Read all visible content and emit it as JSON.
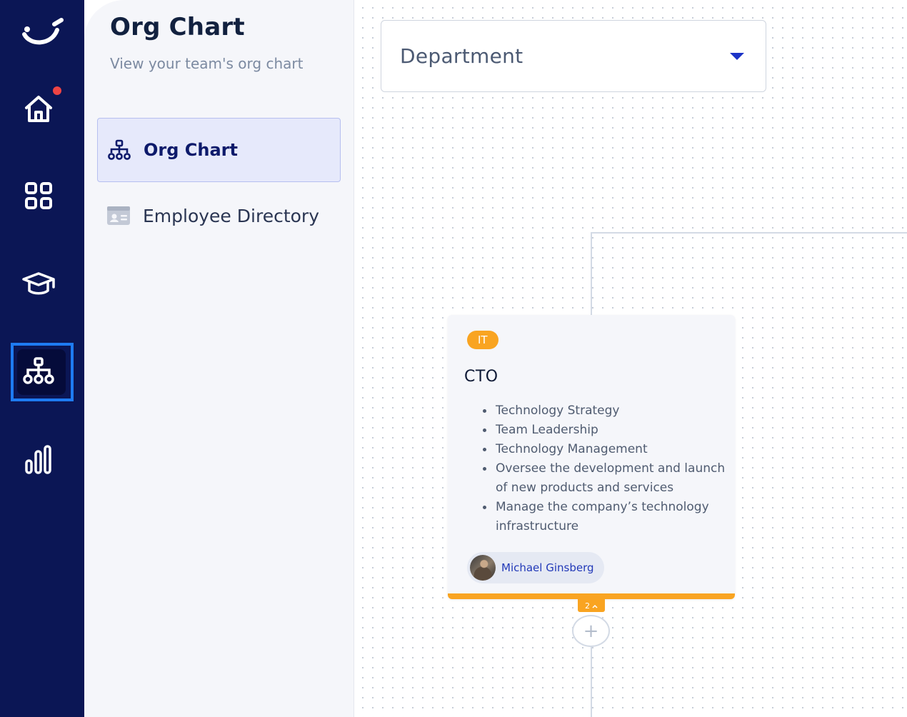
{
  "panel": {
    "title": "Org Chart",
    "subtitle": "View your team's org chart",
    "nav": [
      {
        "label": "Org Chart",
        "icon": "org-chart-icon",
        "active": true
      },
      {
        "label": "Employee Directory",
        "icon": "id-card-icon",
        "active": false
      }
    ]
  },
  "rail": {
    "items": [
      "home-icon",
      "apps-grid-icon",
      "graduation-cap-icon",
      "org-chart-icon",
      "bar-chart-icon"
    ],
    "active": "org-chart-icon",
    "notification": true
  },
  "filter": {
    "department_label": "Department"
  },
  "card": {
    "tag": "IT",
    "role": "CTO",
    "duties": [
      "Technology Strategy",
      "Team Leadership",
      "Technology Management",
      "Oversee the development and launch of new products and services",
      "Manage the company’s technology infrastructure"
    ],
    "person": "Michael Ginsberg",
    "children_count": "2",
    "children_caret": "^"
  },
  "colors": {
    "rail_bg": "#0b1655",
    "accent": "#f9a421",
    "active_frame": "#1e7bf2",
    "brand_text": "#0d1a6b"
  }
}
